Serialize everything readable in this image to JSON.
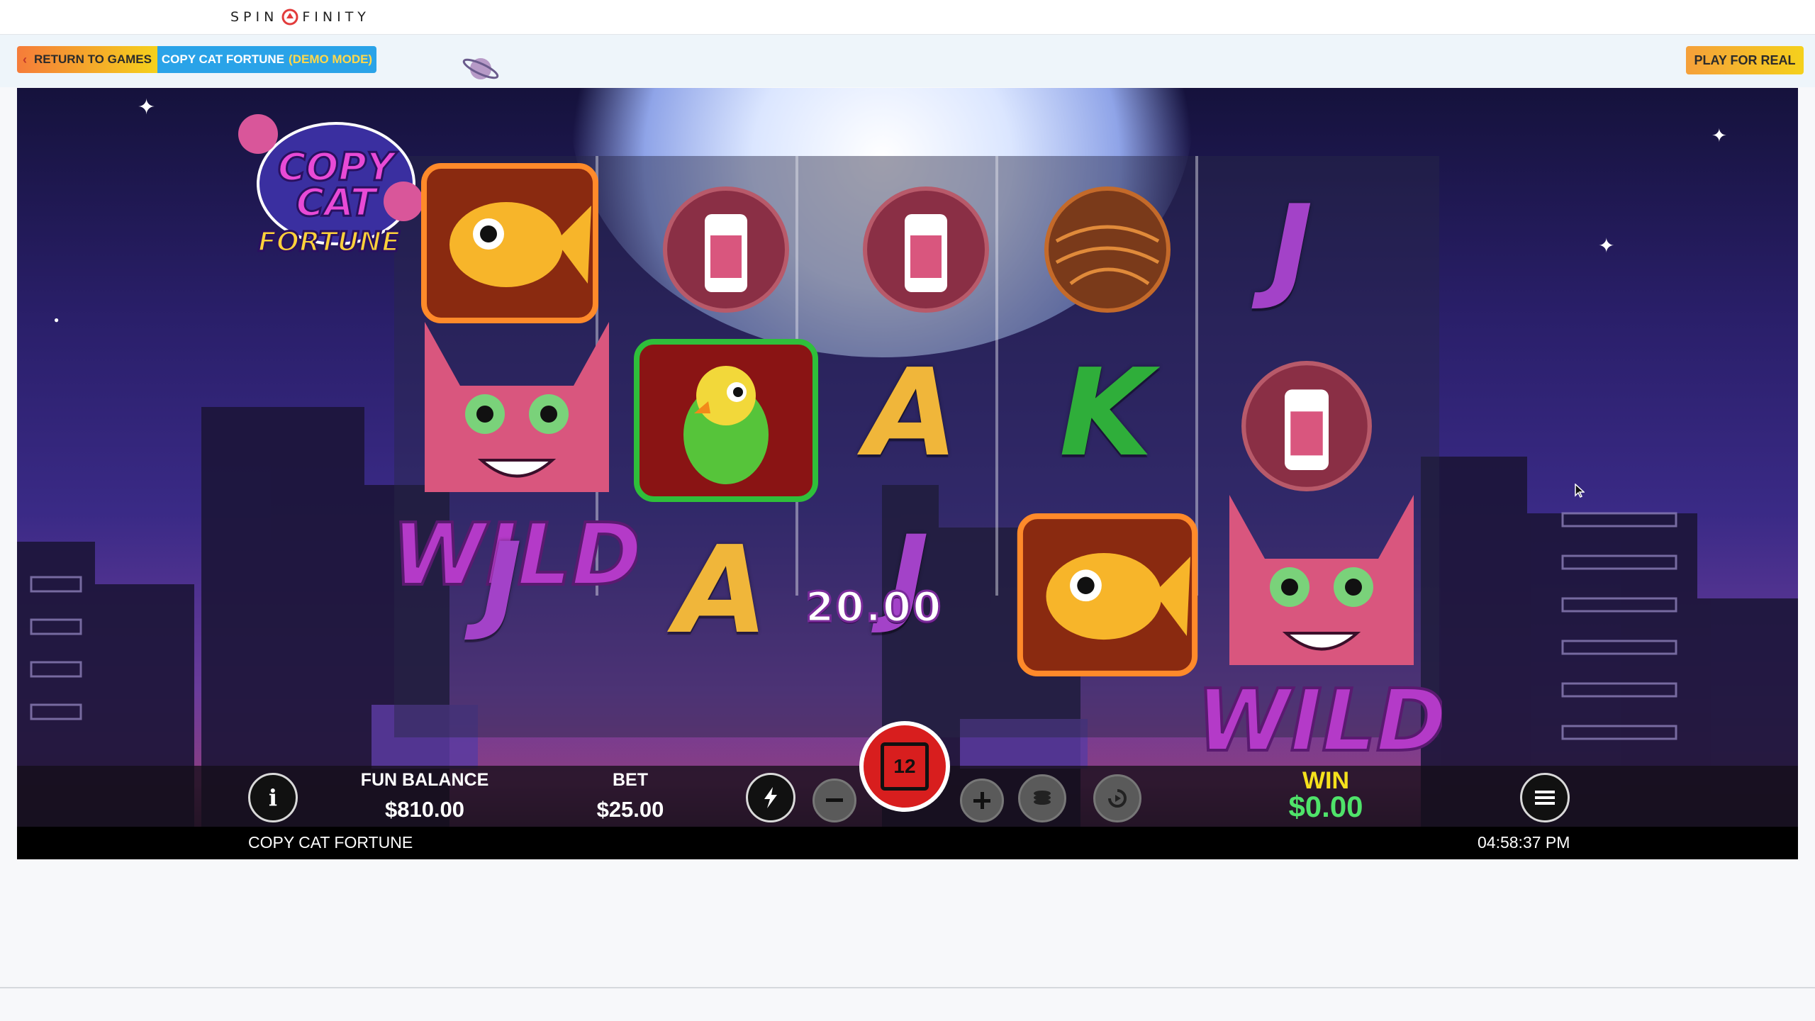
{
  "site": {
    "logo_text_left": "SPIN",
    "logo_text_right": "FINITY",
    "brand_color": "#e23b3b"
  },
  "header": {
    "return_label": "RETURN TO GAMES",
    "game_title": "COPY CAT FORTUNE",
    "mode_label": "(DEMO MODE)",
    "play_real_label": "PLAY FOR REAL"
  },
  "game": {
    "logo_lines": [
      "COPY",
      "CAT",
      "FORTUNE"
    ],
    "win_amount_display": "20.00",
    "reels": [
      [
        "goldfish",
        "wild-cat",
        "J"
      ],
      [
        "milk-bottle",
        "parrot",
        "A"
      ],
      [
        "milk-bottle",
        "A",
        "J"
      ],
      [
        "yarn-ball",
        "K",
        "goldfish"
      ],
      [
        "J",
        "milk-bottle",
        "wild-cat"
      ]
    ],
    "wild_text": "WILD"
  },
  "hud": {
    "balance_label": "FUN BALANCE",
    "balance_value": "$810.00",
    "bet_label": "BET",
    "bet_value": "$25.00",
    "spin_count": "12",
    "win_label": "WIN",
    "win_value": "$0.00",
    "game_name": "COPY CAT FORTUNE",
    "clock": "04:58:37 PM"
  }
}
